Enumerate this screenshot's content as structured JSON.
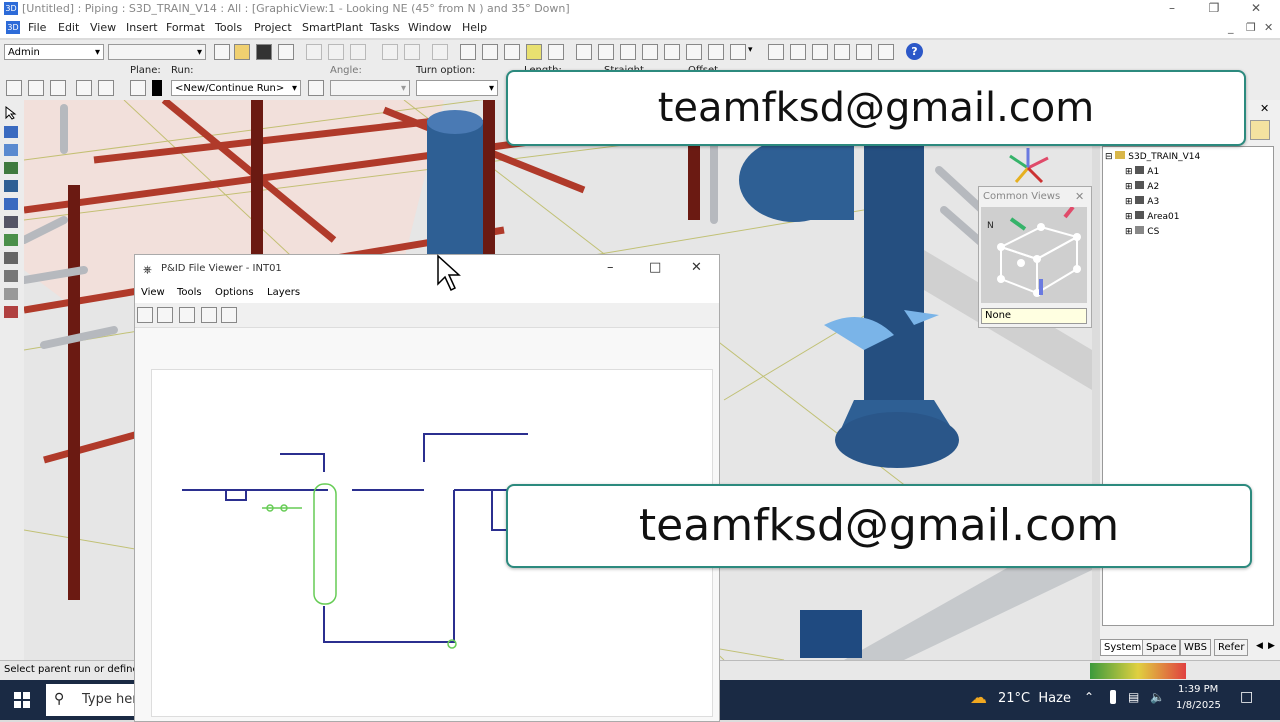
{
  "window": {
    "title": "[Untitled] : Piping : S3D_TRAIN_V14 : All : [GraphicView:1 - Looking NE (45° from N ) and 35° Down]",
    "app_icon": "3D"
  },
  "menubar": {
    "items": [
      "File",
      "Edit",
      "View",
      "Insert",
      "Format",
      "Tools",
      "Project",
      "SmartPlant",
      "Tasks",
      "Window",
      "Help"
    ]
  },
  "toolbar1": {
    "permission_group": "Admin"
  },
  "toolbar2": {
    "plane_label": "Plane:",
    "run_label": "Run:",
    "run_value": "<New/Continue Run>",
    "angle_label": "Angle:",
    "turn_option_label": "Turn option:",
    "length_label": "Length:",
    "straight_label": "Straight",
    "offset_label": "Offset"
  },
  "pid_viewer": {
    "title": "P&ID File Viewer - INT01",
    "menus": [
      "View",
      "Tools",
      "Options",
      "Layers"
    ]
  },
  "common_views": {
    "title": "Common Views",
    "north_label": "N",
    "selection": "None"
  },
  "tree": {
    "root": "S3D_TRAIN_V14",
    "items": [
      "A1",
      "A2",
      "A3",
      "Area01",
      "CS"
    ],
    "tabs": [
      "System",
      "Space",
      "WBS",
      "Refer"
    ]
  },
  "statusbar": {
    "prompt": "Select parent run or define"
  },
  "taskbar": {
    "search_placeholder": "Type here",
    "weather": "21°C  Haze",
    "time": "1:39 PM",
    "date": "1/8/2025"
  },
  "overlay": {
    "email_top": "teamfksd@gmail.com",
    "email_bottom": "teamfksd@gmail.com"
  },
  "colors": {
    "steel": "#b03a2a",
    "vessel": "#2e5f94",
    "pid_line": "#2b2f8f",
    "pid_vessel": "#66cc55",
    "banner_border": "#2c8a7e",
    "taskbar": "#1a2a44"
  }
}
